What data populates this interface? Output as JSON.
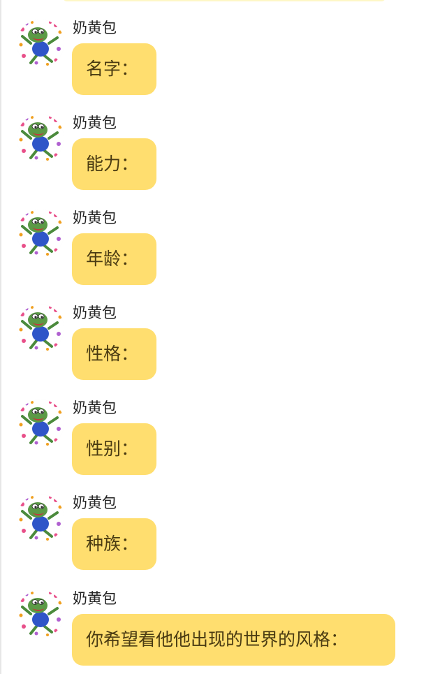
{
  "colors": {
    "bubble": "#ffde6f",
    "background": "#ffffff",
    "text": "#4a3b12",
    "sender_text": "#222222"
  },
  "messages": [
    {
      "sender": "奶黄包",
      "text": "名字：",
      "avatar": "pepe-frog-avatar"
    },
    {
      "sender": "奶黄包",
      "text": "能力：",
      "avatar": "pepe-frog-avatar"
    },
    {
      "sender": "奶黄包",
      "text": "年龄：",
      "avatar": "pepe-frog-avatar"
    },
    {
      "sender": "奶黄包",
      "text": "性格：",
      "avatar": "pepe-frog-avatar"
    },
    {
      "sender": "奶黄包",
      "text": "性别：",
      "avatar": "pepe-frog-avatar"
    },
    {
      "sender": "奶黄包",
      "text": "种族：",
      "avatar": "pepe-frog-avatar"
    },
    {
      "sender": "奶黄包",
      "text": "你希望看他他出现的世界的风格：",
      "avatar": "pepe-frog-avatar"
    }
  ]
}
